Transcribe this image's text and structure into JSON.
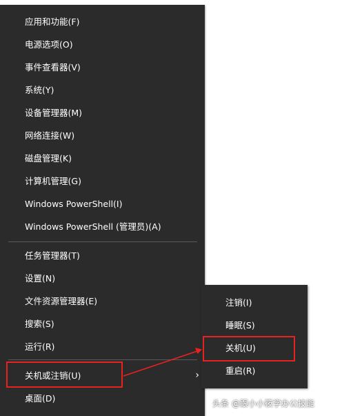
{
  "menu": {
    "items": [
      {
        "label": "应用和功能(F)"
      },
      {
        "label": "电源选项(O)"
      },
      {
        "label": "事件查看器(V)"
      },
      {
        "label": "系统(Y)"
      },
      {
        "label": "设备管理器(M)"
      },
      {
        "label": "网络连接(W)"
      },
      {
        "label": "磁盘管理(K)"
      },
      {
        "label": "计算机管理(G)"
      },
      {
        "label": "Windows PowerShell(I)"
      },
      {
        "label": "Windows PowerShell (管理员)(A)"
      },
      {
        "label": "任务管理器(T)"
      },
      {
        "label": "设置(N)"
      },
      {
        "label": "文件资源管理器(E)"
      },
      {
        "label": "搜索(S)"
      },
      {
        "label": "运行(R)"
      },
      {
        "label": "关机或注销(U)",
        "submenu_arrow": "›"
      },
      {
        "label": "桌面(D)"
      }
    ]
  },
  "submenu": {
    "items": [
      {
        "label": "注销(I)"
      },
      {
        "label": "睡眠(S)"
      },
      {
        "label": "关机(U)"
      },
      {
        "label": "重启(R)"
      }
    ]
  },
  "watermark": {
    "text": "头条 @跟小小筱学办公技能"
  },
  "colors": {
    "menu_background": "#2b2b2b",
    "menu_text": "#ffffff",
    "separator": "#5a5a5a",
    "highlight": "#e8231f"
  }
}
